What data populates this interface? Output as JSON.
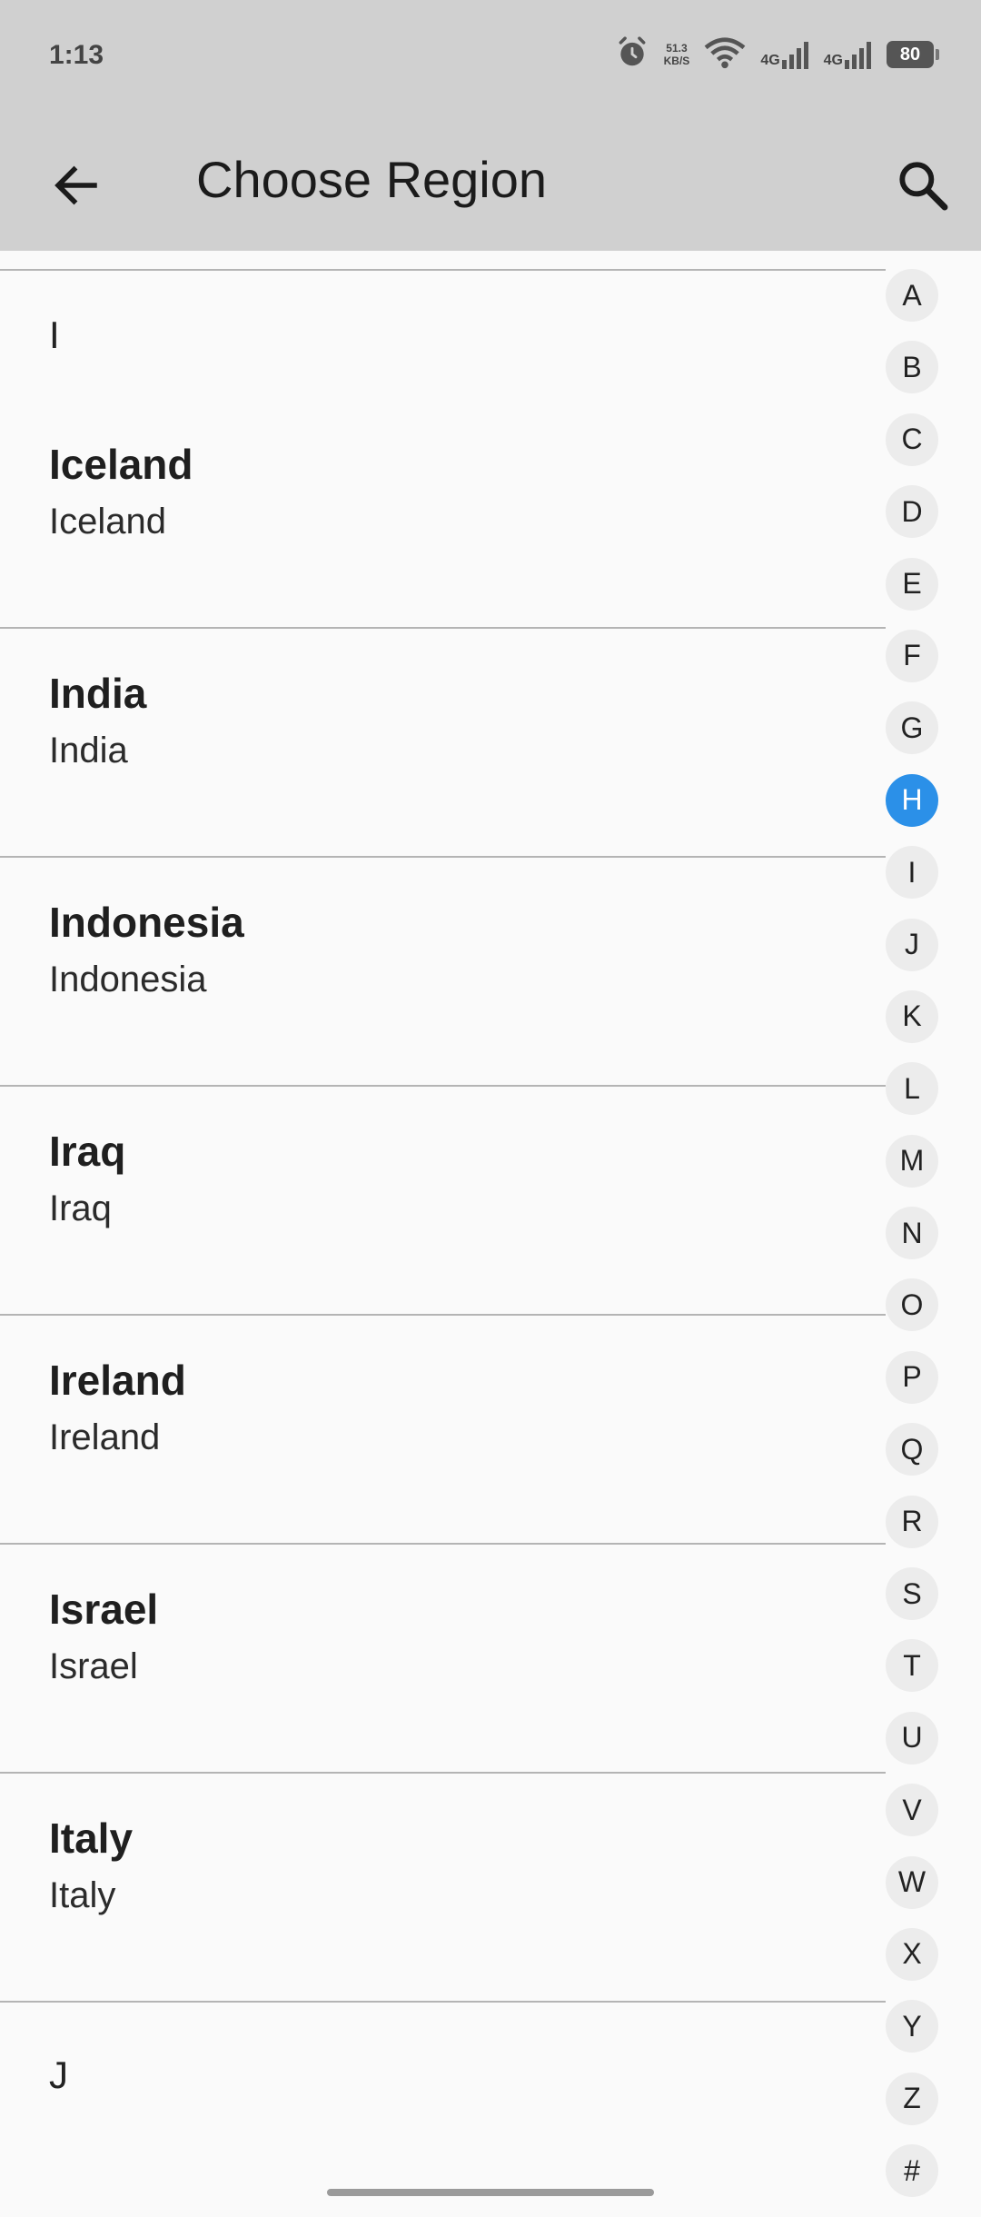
{
  "status": {
    "time": "1:13",
    "net_speed_value": "51.3",
    "net_speed_unit": "KB/S",
    "sim1": "4G",
    "sim2": "4G",
    "battery": "80",
    "icons": [
      "alarm-icon",
      "wifi-icon",
      "signal-icon",
      "signal-icon",
      "battery-icon"
    ]
  },
  "header": {
    "title": "Choose Region",
    "back_icon": "arrow-left-icon",
    "search_icon": "search-icon"
  },
  "list": {
    "section_i": "I",
    "section_j": "J",
    "items": [
      {
        "title": "Iceland",
        "subtitle": "Iceland"
      },
      {
        "title": "India",
        "subtitle": "India"
      },
      {
        "title": "Indonesia",
        "subtitle": "Indonesia"
      },
      {
        "title": "Iraq",
        "subtitle": "Iraq"
      },
      {
        "title": "Ireland",
        "subtitle": "Ireland"
      },
      {
        "title": "Israel",
        "subtitle": "Israel"
      },
      {
        "title": "Italy",
        "subtitle": "Italy"
      }
    ]
  },
  "index": {
    "letters": [
      "A",
      "B",
      "C",
      "D",
      "E",
      "F",
      "G",
      "H",
      "I",
      "J",
      "K",
      "L",
      "M",
      "N",
      "O",
      "P",
      "Q",
      "R",
      "S",
      "T",
      "U",
      "V",
      "W",
      "X",
      "Y",
      "Z",
      "#"
    ],
    "active": "H",
    "active_color": "#2b90e8"
  }
}
